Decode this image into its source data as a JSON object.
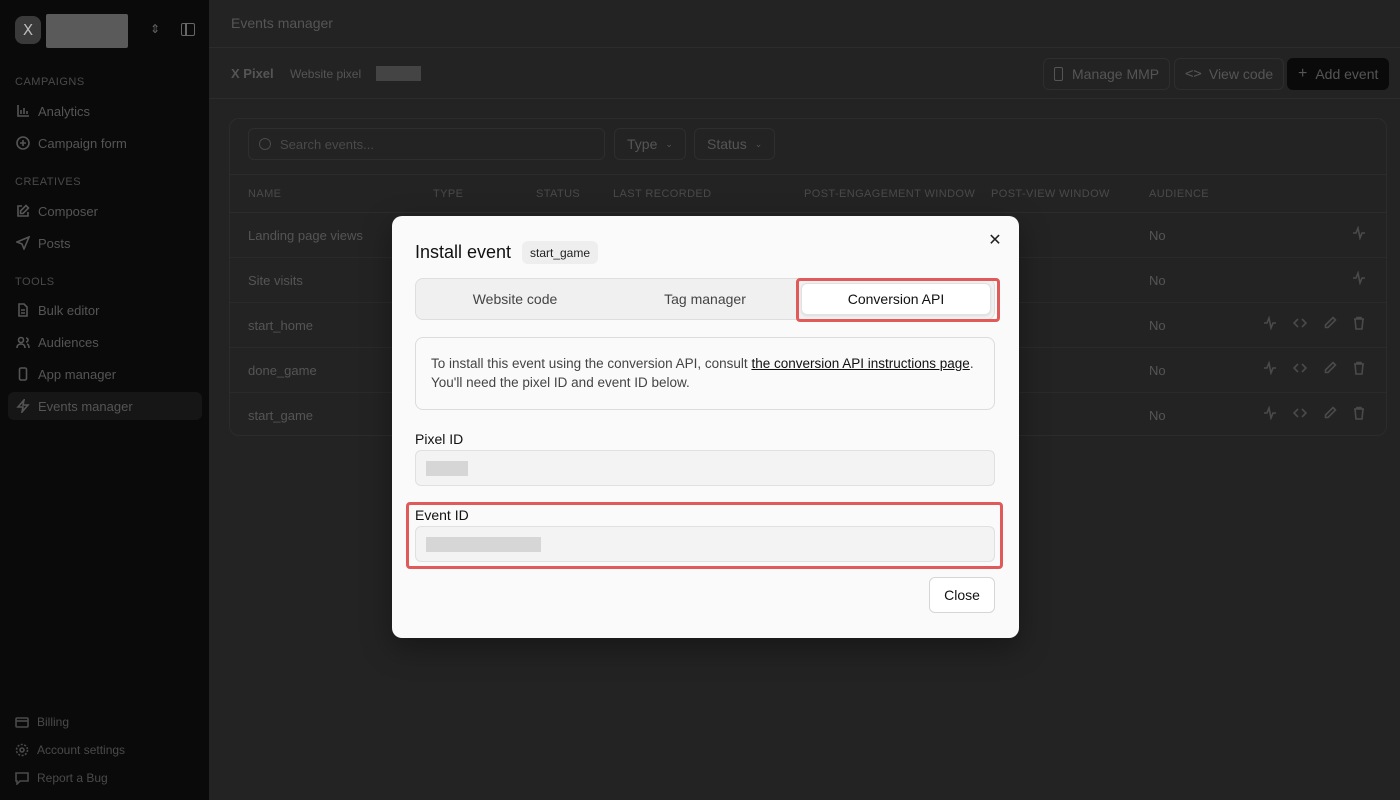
{
  "sidebar": {
    "brand_glyph": "X",
    "sections": [
      {
        "label": "CAMPAIGNS",
        "items": [
          {
            "label": "Analytics",
            "icon": "bar-chart-icon"
          },
          {
            "label": "Campaign form",
            "icon": "plus-circle-icon"
          }
        ]
      },
      {
        "label": "CREATIVES",
        "items": [
          {
            "label": "Composer",
            "icon": "edit-icon"
          },
          {
            "label": "Posts",
            "icon": "send-icon"
          }
        ]
      },
      {
        "label": "TOOLS",
        "items": [
          {
            "label": "Bulk editor",
            "icon": "file-icon"
          },
          {
            "label": "Audiences",
            "icon": "users-icon"
          },
          {
            "label": "App manager",
            "icon": "phone-icon"
          },
          {
            "label": "Events manager",
            "icon": "zap-icon",
            "active": true
          }
        ]
      }
    ],
    "bottom": [
      {
        "label": "Billing",
        "icon": "credit-card-icon"
      },
      {
        "label": "Account settings",
        "icon": "gear-icon"
      },
      {
        "label": "Report a Bug",
        "icon": "message-icon"
      }
    ]
  },
  "header": {
    "title": "Events manager"
  },
  "pixel": {
    "name": "X Pixel",
    "type": "Website pixel",
    "buttons": {
      "manage_mmp": "Manage MMP",
      "view_code": "View code",
      "add_event": "Add event"
    }
  },
  "table": {
    "search_placeholder": "Search events...",
    "filters": {
      "type": "Type",
      "status": "Status"
    },
    "columns": [
      "NAME",
      "TYPE",
      "STATUS",
      "LAST RECORDED",
      "POST-ENGAGEMENT WINDOW",
      "POST-VIEW WINDOW",
      "AUDIENCE"
    ],
    "rows": [
      {
        "name": "Landing page views",
        "audience": "No"
      },
      {
        "name": "Site visits",
        "audience": "No"
      },
      {
        "name": "start_home",
        "audience": "No"
      },
      {
        "name": "done_game",
        "audience": "No"
      },
      {
        "name": "start_game",
        "audience": "No"
      }
    ]
  },
  "modal": {
    "title": "Install event",
    "event_badge": "start_game",
    "tabs": [
      "Website code",
      "Tag manager",
      "Conversion API"
    ],
    "active_tab": "Conversion API",
    "info_prefix": "To install this event using the conversion API, consult ",
    "info_link": "the conversion API instructions page",
    "info_suffix": ". You'll need the pixel ID and event ID below.",
    "pixel_id_label": "Pixel ID",
    "event_id_label": "Event ID",
    "close_label": "Close",
    "highlight_color": "#e05a5a"
  }
}
